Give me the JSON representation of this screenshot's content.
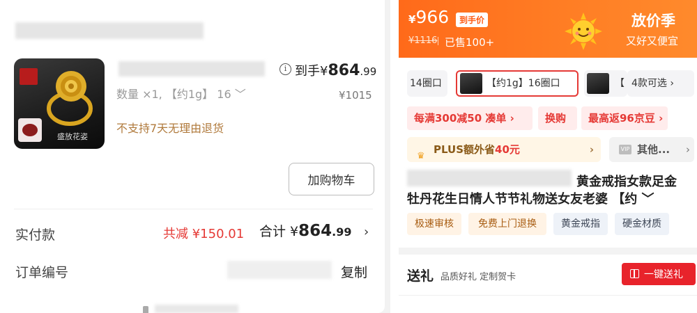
{
  "left": {
    "product": {
      "final_price_label": "到手",
      "final_price_symbol": "¥",
      "final_price_int": "864",
      "final_price_dec": ".99",
      "spec": "数量 ×1, 【约1g】 16 ﹀",
      "original_price": "¥1015",
      "no_return_notice": "不支持7天无理由退货",
      "thumb_caption": "盛放花姿",
      "add_to_cart_label": "加购物车",
      "info_icon": "info-icon"
    },
    "payment": {
      "label": "实付款",
      "discount_text": "共减 ¥150.01",
      "total_label": "合计 ",
      "total_symbol": "¥",
      "total_int": "864",
      "total_dec": ".99",
      "chevron": "›"
    },
    "order": {
      "label": "订单编号",
      "copy_label": "复制"
    }
  },
  "right": {
    "banner": {
      "price_symbol": "¥",
      "price": "966",
      "price_tag": "到手价",
      "strike_price": "¥1116",
      "sold": "已售100+",
      "season_title": "放价季",
      "season_sub": "又好又便宜",
      "mascot_icon": "sun-mascot-icon"
    },
    "options": [
      {
        "label": "14圈口"
      },
      {
        "label": "【约1g】16圈口",
        "selected": true
      },
      {
        "label": "【"
      },
      {
        "label": "4款可选 ›"
      }
    ],
    "promos": [
      {
        "label": "每满300减50 凑单 ›"
      },
      {
        "label": "换购"
      },
      {
        "label": "最高返96京豆 ›"
      }
    ],
    "plus": {
      "prefix": "PLUS额外省",
      "amount": "40元",
      "chevron": "›"
    },
    "vip": {
      "badge": "VIP",
      "label": "其他...",
      "chevron": "›"
    },
    "title_line1": "黄金戒指女款足金",
    "title_line2": "牡丹花生日情人节节礼物送女友老婆 【约 ﹀",
    "tags": [
      {
        "label": "极速审核",
        "style": "warm"
      },
      {
        "label": "免费上门退换",
        "style": "warm"
      },
      {
        "label": "黄金戒指",
        "style": "cool"
      },
      {
        "label": "硬金材质",
        "style": "cool"
      }
    ],
    "gift": {
      "label": "送礼",
      "sub": "品质好礼 定制贺卡",
      "button": "一键送礼"
    }
  },
  "colors": {
    "accent_red": "#e53935",
    "banner_orange": "#ff7d24",
    "warm_text": "#b07a3c"
  }
}
